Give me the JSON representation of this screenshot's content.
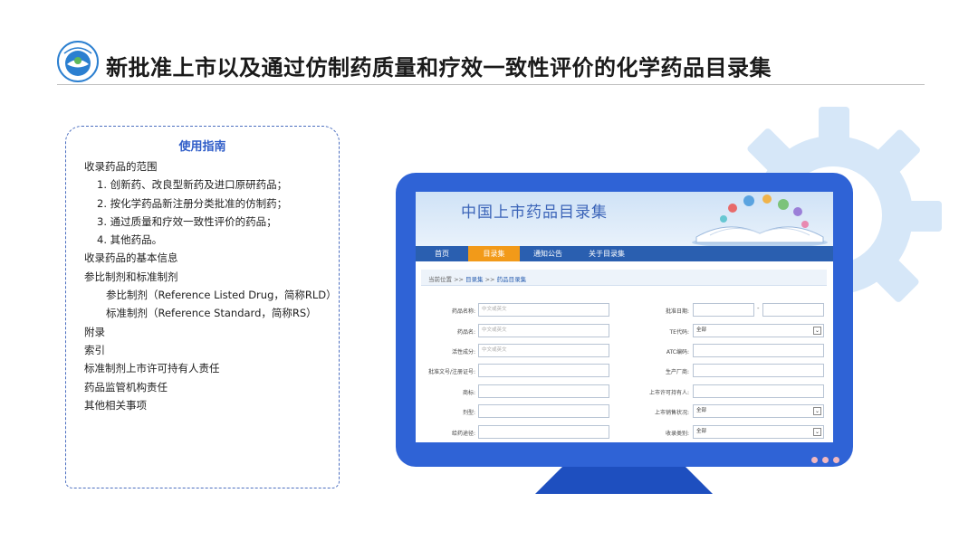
{
  "header": {
    "logo_text": "",
    "title": "新批准上市以及通过仿制药质量和疗效一致性评价的化学药品目录集"
  },
  "guide": {
    "title": "使用指南",
    "items": [
      {
        "label": "收录药品的范围",
        "level": 0
      },
      {
        "label": "1. 创新药、改良型新药及进口原研药品；",
        "level": 1
      },
      {
        "label": "2. 按化学药品新注册分类批准的仿制药；",
        "level": 1
      },
      {
        "label": "3. 通过质量和疗效一致性评价的药品；",
        "level": 1
      },
      {
        "label": "4. 其他药品。",
        "level": 1
      },
      {
        "label": "收录药品的基本信息",
        "level": 0
      },
      {
        "label": "参比制剂和标准制剂",
        "level": 0
      },
      {
        "label": "参比制剂（Reference Listed Drug，简称RLD）",
        "level": 2
      },
      {
        "label": "标准制剂（Reference Standard，简称RS）",
        "level": 2
      },
      {
        "label": "附录",
        "level": 0
      },
      {
        "label": "索引",
        "level": 0
      },
      {
        "label": "标准制剂上市许可持有人责任",
        "level": 0
      },
      {
        "label": "药品监管机构责任",
        "level": 0
      },
      {
        "label": "其他相关事项",
        "level": 0
      }
    ]
  },
  "site": {
    "banner_title": "中国上市药品目录集",
    "nav": [
      {
        "label": "首页",
        "active": false
      },
      {
        "label": "目录集",
        "active": true
      },
      {
        "label": "通知公告",
        "active": false
      },
      {
        "label": "关于目录集",
        "active": false
      }
    ],
    "breadcrumb": {
      "prefix": "当前位置 >> ",
      "link": "目录集",
      "sep": " >> ",
      "current": "药品目录集"
    },
    "form_left": [
      {
        "label": "药品名称:",
        "placeholder": "中文或英文"
      },
      {
        "label": "药品名:",
        "placeholder": "中文或英文"
      },
      {
        "label": "活性成分:",
        "placeholder": "中文或英文"
      },
      {
        "label": "批准文号/注册证号:",
        "placeholder": ""
      },
      {
        "label": "商标:",
        "placeholder": ""
      },
      {
        "label": "剂型:",
        "placeholder": ""
      },
      {
        "label": "给药途径:",
        "placeholder": ""
      }
    ],
    "form_right": [
      {
        "label": "批准日期:",
        "type": "daterange",
        "value": ""
      },
      {
        "label": "TE代码:",
        "type": "select",
        "value": "全部"
      },
      {
        "label": "ATC编码:",
        "type": "input",
        "value": ""
      },
      {
        "label": "生产厂商:",
        "type": "input",
        "value": ""
      },
      {
        "label": "上市许可持有人:",
        "type": "input",
        "value": ""
      },
      {
        "label": "上市销售状况:",
        "type": "select",
        "value": "全部"
      },
      {
        "label": "收录类别:",
        "type": "select",
        "value": "全部"
      }
    ],
    "date_separator": "-"
  },
  "colors": {
    "accent_blue": "#2f63d6",
    "nav_blue": "#2a5fb0",
    "nav_active": "#f29a19",
    "gear": "#d9e9f8",
    "guide_title": "#2f5dc8"
  }
}
